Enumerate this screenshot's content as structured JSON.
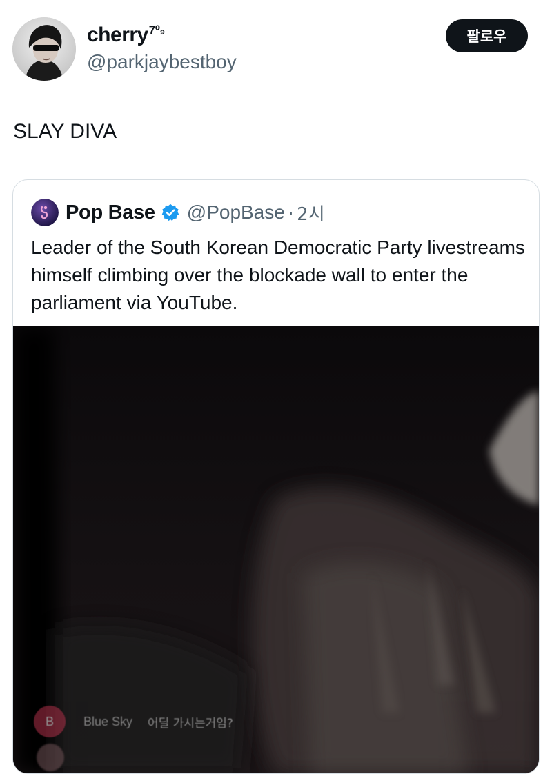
{
  "tweet": {
    "display_name": "cherry",
    "name_badge": "7⁰₉",
    "handle": "@parkjaybestboy",
    "follow_label": "팔로우",
    "text": "SLAY DIVA"
  },
  "quoted_tweet": {
    "display_name": "Pop Base",
    "handle": "@PopBase",
    "separator": "·",
    "time": "2시",
    "text": "Leader of the South Korean Democratic Party livestreams himself climbing over the blockade wall to enter the parliament via YouTube.",
    "verified_color": "#1d9bf0"
  },
  "video_overlay": {
    "chat_avatar_letter": "B",
    "chat_user": "Blue Sky",
    "chat_message": "어딜 가시는거임?"
  },
  "icons": {
    "verified": "verified-badge-icon"
  }
}
